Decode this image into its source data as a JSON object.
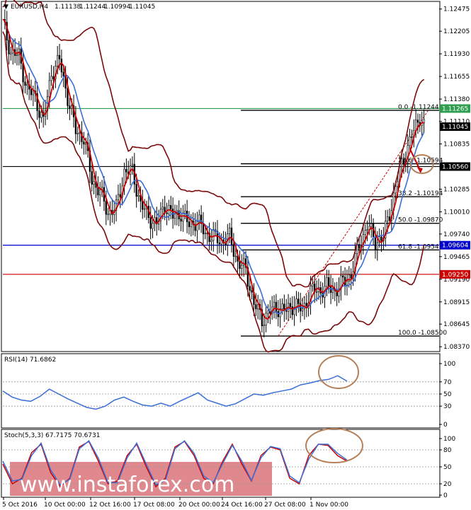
{
  "chart_data": [
    {
      "type": "candlestick",
      "title": "EURUSD,H4",
      "quote_values": [
        "1.11138",
        "1.11244",
        "1.10994",
        "1.11045"
      ],
      "y_ticks": [
        "1.12475",
        "1.12205",
        "1.11930",
        "1.11655",
        "1.11380",
        "1.11110",
        "1.10835",
        "1.10560",
        "1.10285",
        "1.10010",
        "1.09740",
        "1.09465",
        "1.09190",
        "1.08915",
        "1.08645",
        "1.08370"
      ],
      "x_ticks": [
        "5 Oct 2016",
        "10 Oct 00:00",
        "12 Oct 16:00",
        "17 Oct 08:00",
        "20 Oct 00:00",
        "24 Oct 16:00",
        "27 Oct 08:00",
        "1 Nov 00:00"
      ],
      "ylim": [
        1.0832,
        1.1255
      ],
      "close_path": [
        [
          0,
          1.123
        ],
        [
          4,
          1.1195
        ],
        [
          8,
          1.119
        ],
        [
          12,
          1.115
        ],
        [
          16,
          1.114
        ],
        [
          20,
          1.111
        ],
        [
          24,
          1.117
        ],
        [
          28,
          1.1185
        ],
        [
          32,
          1.114
        ],
        [
          36,
          1.11
        ],
        [
          40,
          1.109
        ],
        [
          44,
          1.104
        ],
        [
          48,
          1.1025
        ],
        [
          52,
          1.1
        ],
        [
          56,
          1.1005
        ],
        [
          60,
          1.105
        ],
        [
          64,
          1.105
        ],
        [
          68,
          1.101
        ],
        [
          72,
          1.0995
        ],
        [
          76,
          1.0985
        ],
        [
          80,
          1.101
        ],
        [
          84,
          1.0995
        ],
        [
          88,
          1.1
        ],
        [
          92,
          1.0985
        ],
        [
          96,
          1.099
        ],
        [
          100,
          1.0975
        ],
        [
          104,
          1.097
        ],
        [
          108,
          1.0965
        ],
        [
          112,
          1.097
        ],
        [
          116,
          1.094
        ],
        [
          120,
          1.093
        ],
        [
          124,
          1.089
        ],
        [
          128,
          1.087
        ],
        [
          132,
          1.088
        ],
        [
          136,
          1.0885
        ],
        [
          140,
          1.088
        ],
        [
          144,
          1.089
        ],
        [
          148,
          1.088
        ],
        [
          152,
          1.0905
        ],
        [
          156,
          1.0905
        ],
        [
          160,
          1.091
        ],
        [
          164,
          1.0905
        ],
        [
          168,
          1.0915
        ],
        [
          172,
          1.0925
        ],
        [
          176,
          1.096
        ],
        [
          180,
          1.0985
        ],
        [
          184,
          1.0965
        ],
        [
          188,
          1.097
        ],
        [
          192,
          1.101
        ],
        [
          196,
          1.105
        ],
        [
          200,
          1.108
        ],
        [
          204,
          1.1105
        ],
        [
          206,
          1.1118
        ],
        [
          208,
          1.1105
        ]
      ],
      "overlays": [
        {
          "name": "MA-red",
          "color": "#cc0000"
        },
        {
          "name": "MA-blue",
          "color": "#3a6fd8"
        },
        {
          "name": "Bollinger",
          "color": "#7a0a0a"
        }
      ],
      "levels": [
        {
          "price": 1.11265,
          "label": "1.11265",
          "color": "#2e9e4f"
        },
        {
          "price": 1.1056,
          "label": "1.10560",
          "color": "#000000"
        },
        {
          "price": 1.09604,
          "label": "1.09604",
          "color": "#0000cc"
        },
        {
          "price": 1.0925,
          "label": "1.09250",
          "color": "#cc0000"
        },
        {
          "price": 1.11045,
          "label": "1.11045",
          "color": "#000000"
        }
      ],
      "fibonacci": [
        {
          "label": "0.0 -1.11244",
          "price": 1.11244
        },
        {
          "label": "23.6 -1.10594",
          "price": 1.10594
        },
        {
          "label": "38.2 -1.10194",
          "price": 1.10194
        },
        {
          "label": "50.0 -1.09870",
          "price": 1.0987
        },
        {
          "label": "61.8 -1.09547",
          "price": 1.09547
        },
        {
          "label": "100.0 -1.08500",
          "price": 1.085
        }
      ]
    },
    {
      "type": "line",
      "title": "RSI(14) 71.6862",
      "y_ticks": [
        "100",
        "70",
        "50",
        "30",
        "0"
      ],
      "ylim": [
        0,
        100
      ],
      "series": [
        {
          "color": "#3a6fd8",
          "values": [
            55,
            45,
            40,
            38,
            46,
            58,
            50,
            42,
            35,
            28,
            25,
            30,
            40,
            45,
            38,
            32,
            30,
            35,
            30,
            38,
            45,
            52,
            40,
            35,
            30,
            34,
            42,
            50,
            48,
            52,
            55,
            58,
            65,
            68,
            72,
            74,
            80,
            71
          ]
        }
      ]
    },
    {
      "type": "line",
      "title": "Stoch(5,3,3) 67.7175 70.6731",
      "y_ticks": [
        "100",
        "80",
        "50",
        "20",
        "0"
      ],
      "ylim": [
        0,
        100
      ],
      "series": [
        {
          "color": "#cc0000",
          "values": [
            55,
            20,
            30,
            75,
            90,
            40,
            15,
            30,
            85,
            95,
            60,
            20,
            25,
            70,
            90,
            50,
            15,
            30,
            85,
            95,
            70,
            30,
            20,
            60,
            90,
            55,
            25,
            70,
            85,
            80,
            30,
            20,
            70,
            90,
            88,
            70,
            60
          ]
        },
        {
          "color": "#3a6fd8",
          "values": [
            60,
            25,
            28,
            70,
            92,
            45,
            18,
            28,
            82,
            96,
            65,
            22,
            22,
            66,
            92,
            55,
            18,
            26,
            82,
            96,
            74,
            34,
            22,
            56,
            88,
            60,
            26,
            66,
            86,
            82,
            34,
            22,
            64,
            90,
            90,
            74,
            62
          ]
        }
      ]
    }
  ],
  "watermark": "www.instaforex.com",
  "annotation_colors": {
    "ellipse": "#b5805a",
    "arrow": "#cc0000"
  }
}
